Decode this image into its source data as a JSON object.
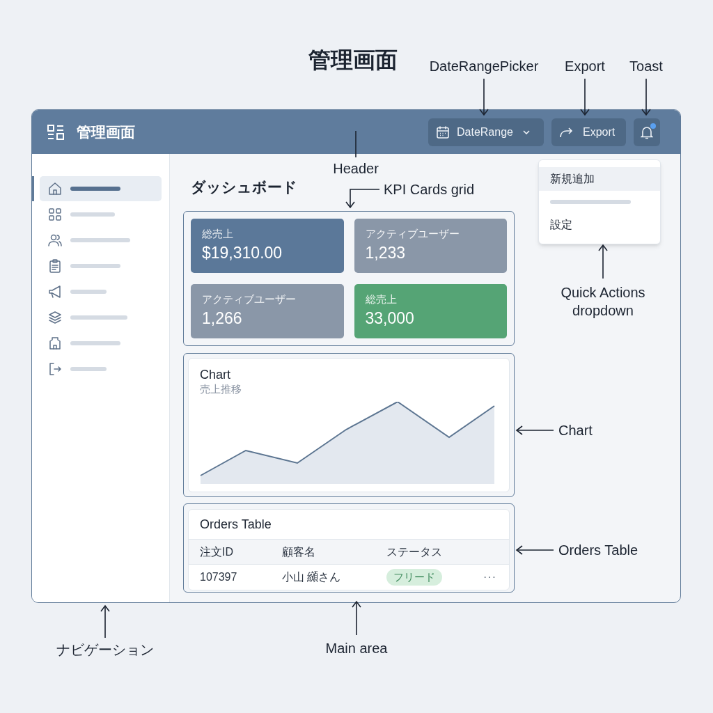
{
  "page_title": "管理画面",
  "header": {
    "title": "管理画面",
    "date_range": {
      "label": "DateRange"
    },
    "export_button": {
      "label": "Export"
    },
    "notifications": {
      "unread": true
    }
  },
  "sidebar": {
    "items": [
      {
        "selected": true
      },
      {
        "selected": false
      },
      {
        "selected": false
      },
      {
        "selected": false
      },
      {
        "selected": false
      },
      {
        "selected": false
      },
      {
        "selected": false
      },
      {
        "selected": false
      }
    ]
  },
  "main": {
    "title": "ダッシュボード",
    "kpi_cards": [
      {
        "label": "総売上",
        "value": "$19,310.00",
        "color": "#5b7899"
      },
      {
        "label": "アクティブユーザー",
        "value": "1,233",
        "color": "#8a97a8"
      },
      {
        "label": "アクティブユーザー",
        "value": "1,266",
        "color": "#8a97a8"
      },
      {
        "label": "総売上",
        "value": "33,000",
        "color": "#55a475"
      }
    ],
    "chart": {
      "title": "Chart",
      "subtitle": "売上推移"
    },
    "orders_table": {
      "title": "Orders Table",
      "columns": [
        "注文ID",
        "顧客名",
        "ステータス"
      ],
      "rows": [
        {
          "order_id": "107397",
          "customer": "小山 纐さん",
          "status": "フリード",
          "color": "#d6eedd",
          "actions": "···"
        }
      ]
    }
  },
  "quick_actions": {
    "items": [
      {
        "kind": "item",
        "label": "新規追加",
        "selected": true
      },
      {
        "kind": "separator"
      },
      {
        "kind": "item",
        "label": "設定",
        "selected": false
      }
    ]
  },
  "annotations": [
    {
      "label": "DateRangePicker"
    },
    {
      "label": "Export"
    },
    {
      "label": "Toast"
    },
    {
      "label": "Header"
    },
    {
      "label": "KPI Cards grid"
    },
    {
      "label": "Quick Actions dropdown"
    },
    {
      "label": "Chart"
    },
    {
      "label": "Orders Table"
    },
    {
      "label": "ナビゲーション"
    },
    {
      "label": "Main area"
    }
  ]
}
